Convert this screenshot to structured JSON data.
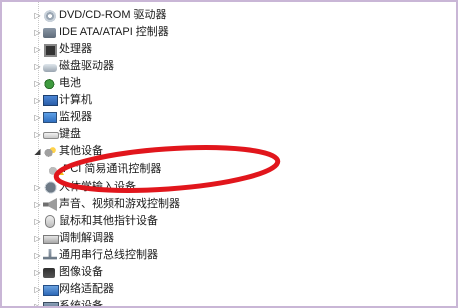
{
  "tree": {
    "items": [
      {
        "label": "DVD/CD-ROM 驱动器",
        "icon": "dvd-drive-icon",
        "expander": "▷"
      },
      {
        "label": "IDE ATA/ATAPI 控制器",
        "icon": "ide-controller-icon",
        "expander": "▷"
      },
      {
        "label": "处理器",
        "icon": "processor-icon",
        "expander": "▷"
      },
      {
        "label": "磁盘驱动器",
        "icon": "disk-drive-icon",
        "expander": "▷"
      },
      {
        "label": "电池",
        "icon": "battery-icon",
        "expander": "▷"
      },
      {
        "label": "计算机",
        "icon": "computer-icon",
        "expander": "▷"
      },
      {
        "label": "监视器",
        "icon": "monitor-icon",
        "expander": "▷"
      },
      {
        "label": "键盘",
        "icon": "keyboard-icon",
        "expander": "▷"
      },
      {
        "label": "其他设备",
        "icon": "other-devices-icon",
        "expander": "◢"
      },
      {
        "label": "PCI 简易通讯控制器",
        "icon": "warning-device-icon",
        "expander": ""
      },
      {
        "label": "人体学输入设备",
        "icon": "hid-icon",
        "expander": "▷"
      },
      {
        "label": "声音、视频和游戏控制器",
        "icon": "audio-icon",
        "expander": "▷"
      },
      {
        "label": "鼠标和其他指针设备",
        "icon": "mouse-icon",
        "expander": "▷"
      },
      {
        "label": "调制解调器",
        "icon": "modem-icon",
        "expander": "▷"
      },
      {
        "label": "通用串行总线控制器",
        "icon": "usb-icon",
        "expander": "▷"
      },
      {
        "label": "图像设备",
        "icon": "imaging-device-icon",
        "expander": "▷"
      },
      {
        "label": "网络适配器",
        "icon": "network-adapter-icon",
        "expander": "▷"
      },
      {
        "label": "系统设备",
        "icon": "system-device-icon",
        "expander": "▷"
      }
    ]
  },
  "annotation": {
    "shape": "ellipse",
    "color": "#e1161c",
    "encircles": "PCI 简易通讯控制器"
  },
  "colors": {
    "frame_border": "#c9b6d6",
    "text": "#1a1a1a",
    "warning": "#f3c21b"
  }
}
